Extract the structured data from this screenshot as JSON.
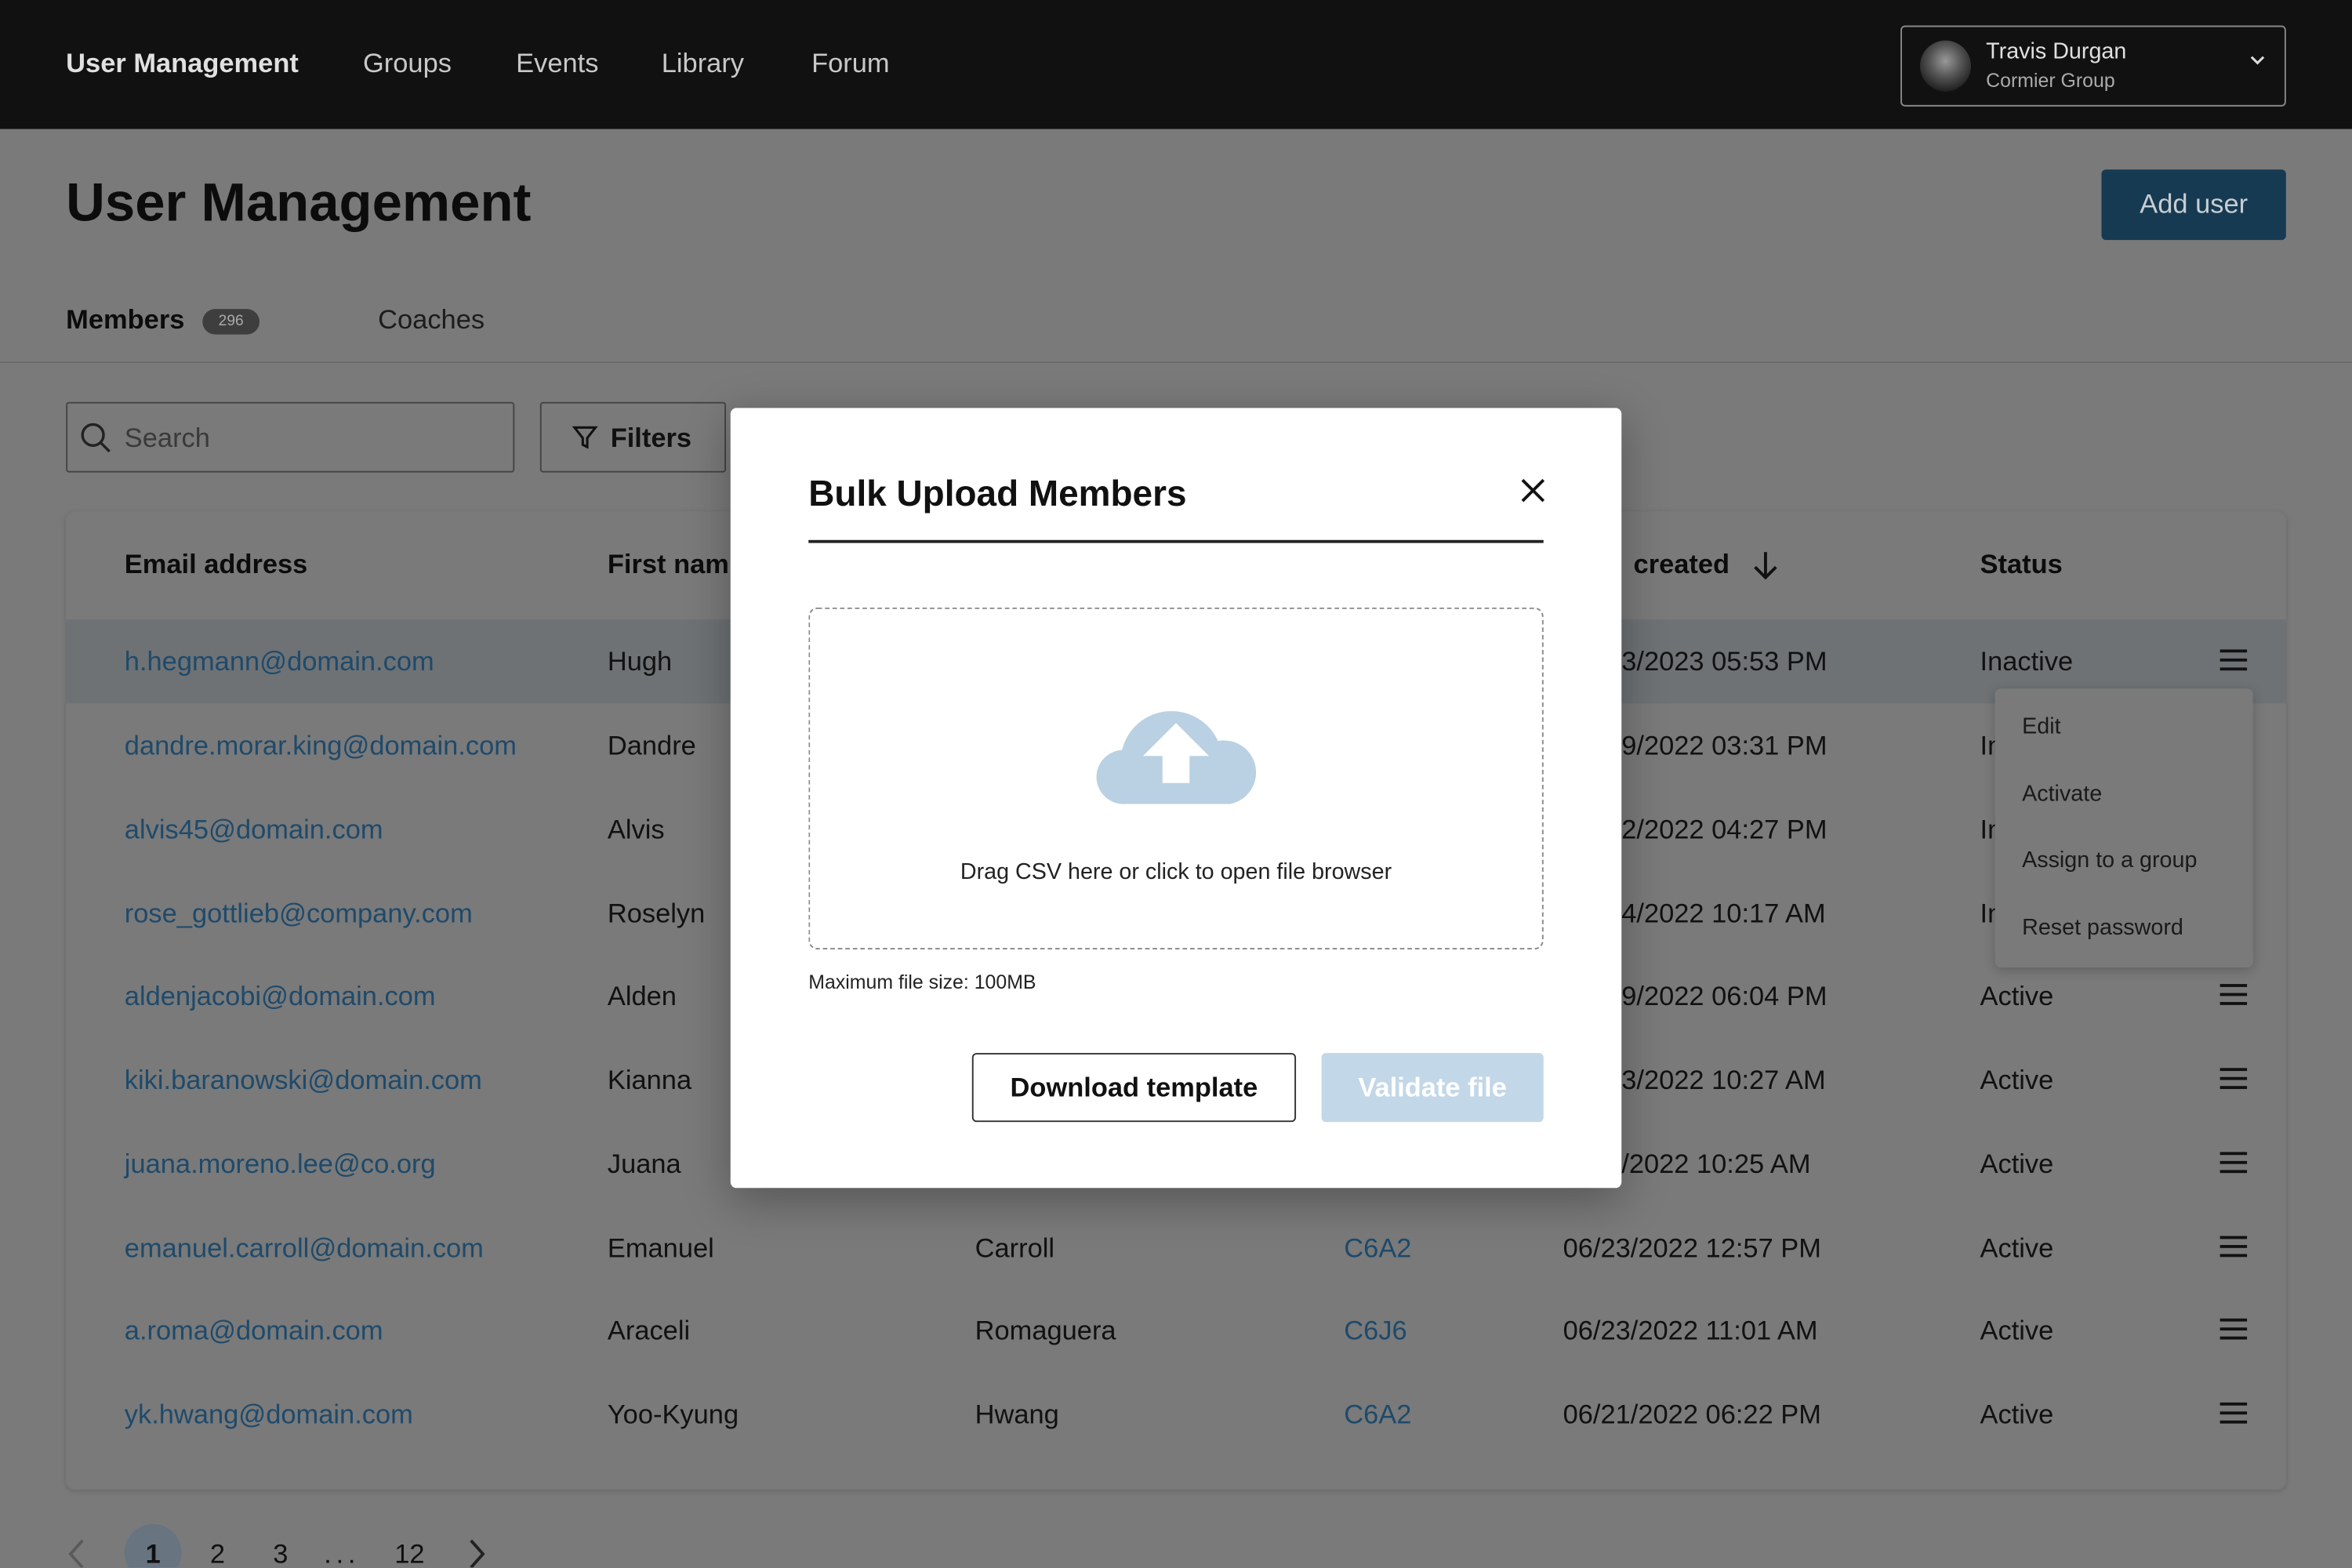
{
  "nav": {
    "items": [
      "User Management",
      "Groups",
      "Events",
      "Library",
      "Forum"
    ],
    "user": {
      "name": "Travis Durgan",
      "org": "Cormier Group"
    }
  },
  "page": {
    "title": "User Management",
    "add_user": "Add user"
  },
  "tabs": {
    "members": "Members",
    "members_count": "296",
    "coaches": "Coaches"
  },
  "toolbar": {
    "search_placeholder": "Search",
    "filters": "Filters"
  },
  "table": {
    "headers": {
      "email": "Email address",
      "first": "First nam",
      "date": "created",
      "status": "Status"
    },
    "rows": [
      {
        "email": "h.hegmann@domain.com",
        "first": "Hugh",
        "last": "",
        "code": "",
        "date": "3/2023 05:53 PM",
        "status": "Inactive"
      },
      {
        "email": "dandre.morar.king@domain.com",
        "first": "Dandre",
        "last": "",
        "code": "",
        "date": "9/2022 03:31 PM",
        "status": "Inactive"
      },
      {
        "email": "alvis45@domain.com",
        "first": "Alvis",
        "last": "",
        "code": "",
        "date": "2/2022 04:27 PM",
        "status": "Inactive"
      },
      {
        "email": "rose_gottlieb@company.com",
        "first": "Roselyn",
        "last": "",
        "code": "",
        "date": "4/2022 10:17 AM",
        "status": "Inactive"
      },
      {
        "email": "aldenjacobi@domain.com",
        "first": "Alden",
        "last": "",
        "code": "",
        "date": "9/2022 06:04 PM",
        "status": "Active"
      },
      {
        "email": "kiki.baranowski@domain.com",
        "first": "Kianna",
        "last": "",
        "code": "",
        "date": "3/2022 10:27 AM",
        "status": "Active"
      },
      {
        "email": "juana.moreno.lee@co.org",
        "first": "Juana",
        "last": "",
        "code": "",
        "date": "/2022 10:25 AM",
        "status": "Active"
      },
      {
        "email": "emanuel.carroll@domain.com",
        "first": "Emanuel",
        "last": "Carroll",
        "code": "C6A2",
        "date": "06/23/2022 12:57 PM",
        "status": "Active"
      },
      {
        "email": "a.roma@domain.com",
        "first": "Araceli",
        "last": "Romaguera",
        "code": "C6J6",
        "date": "06/23/2022 11:01 AM",
        "status": "Active"
      },
      {
        "email": "yk.hwang@domain.com",
        "first": "Yoo-Kyung",
        "last": "Hwang",
        "code": "C6A2",
        "date": "06/21/2022 06:22 PM",
        "status": "Active"
      }
    ]
  },
  "row_menu": [
    "Edit",
    "Activate",
    "Assign to a group",
    "Reset password"
  ],
  "pagination": {
    "pages": [
      "1",
      "2",
      "3",
      "...",
      "12"
    ],
    "current": "1"
  },
  "modal": {
    "title": "Bulk Upload Members",
    "drop_text": "Drag CSV here or click to open file browser",
    "max_size": "Maximum file size: 100MB",
    "download": "Download template",
    "validate": "Validate file"
  },
  "colors": {
    "accent": "#2a6c9e",
    "link": "#2c6ea3",
    "cloud": "#b9d1e2",
    "disabled_button": "#c2d7e7"
  }
}
